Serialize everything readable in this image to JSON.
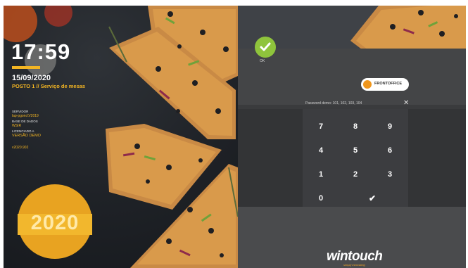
{
  "left": {
    "clock": "17:59",
    "date": "15/09/2020",
    "posto": "POSTO 1 // Serviço de mesas",
    "server_label": "SERVIDOR",
    "server_value": "lap-pgonc\\V2019",
    "db_label": "BASE DE DADOS",
    "db_value": "WSIR",
    "license_label": "LICENCIADO A",
    "license_value": "VERSÃO DEMO",
    "version": "v2020.902",
    "badge_year": "2020"
  },
  "right": {
    "ok_label": "OK",
    "toggle_label": "FRONTOFFICE",
    "password_hint": "Password demo: 101, 102, 103, 104",
    "close_glyph": "✕",
    "keys": [
      "7",
      "8",
      "9",
      "4",
      "5",
      "6",
      "1",
      "2",
      "3",
      "0"
    ],
    "confirm_glyph": "✔",
    "logo_text": "wintouch",
    "logo_tagline": "simply innovating"
  },
  "colors": {
    "accent": "#f3b523",
    "ok_green": "#8fc43c",
    "toggle_orange": "#f0961b"
  }
}
